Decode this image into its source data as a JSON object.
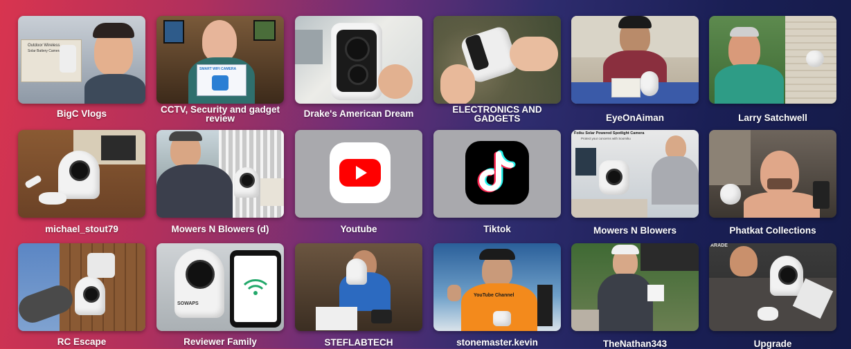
{
  "channels": [
    {
      "label": "BigC Vlogs",
      "icon": "video-thumbnail-icon"
    },
    {
      "label": "CCTV, Security and gadget review",
      "icon": "video-thumbnail-icon"
    },
    {
      "label": "Drake's American Dream",
      "icon": "video-thumbnail-icon"
    },
    {
      "label": "ELECTRONICS AND GADGETS",
      "icon": "video-thumbnail-icon"
    },
    {
      "label": "EyeOnAiman",
      "icon": "video-thumbnail-icon"
    },
    {
      "label": "Larry Satchwell",
      "icon": "video-thumbnail-icon"
    },
    {
      "label": "michael_stout79",
      "icon": "video-thumbnail-icon"
    },
    {
      "label": "Mowers N Blowers (d)",
      "icon": "video-thumbnail-icon"
    },
    {
      "label": "Youtube",
      "icon": "youtube-logo-icon"
    },
    {
      "label": "Tiktok",
      "icon": "tiktok-logo-icon"
    },
    {
      "label": "Mowers N Blowers",
      "icon": "video-thumbnail-icon"
    },
    {
      "label": "Phatkat Collections",
      "icon": "video-thumbnail-icon"
    },
    {
      "label": "RC Escape",
      "icon": "video-thumbnail-icon"
    },
    {
      "label": "Reviewer Family",
      "icon": "video-thumbnail-icon"
    },
    {
      "label": "STEFLABTECH",
      "icon": "video-thumbnail-icon"
    },
    {
      "label": "stonemaster.kevin",
      "icon": "video-thumbnail-icon"
    },
    {
      "label": "TheNathan343",
      "icon": "video-thumbnail-icon"
    },
    {
      "label": "Upgrade",
      "icon": "video-thumbnail-icon"
    }
  ],
  "thumb_texts": {
    "box1_line1": "Outdoor Wireless",
    "box1_line2": "Solar Battery Camera",
    "box2": "SMART WIFI CAMERA",
    "nathan_banner": "Foiku Solar Powered Spotlight Camera",
    "nathan_sub": "Protect your concerns with Soomiku",
    "kevin_sign": "YouTube Channel",
    "upgrade_tag": "ARADE"
  },
  "colors": {
    "youtube_red": "#ff0000",
    "tiktok_bg": "#000000",
    "tile_grey": "#a9a9ad"
  }
}
